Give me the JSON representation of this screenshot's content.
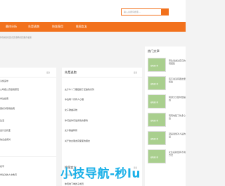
{
  "search": {
    "placeholder": "输入关键词搜索..."
  },
  "nav": {
    "items": [
      "最终分析",
      "先是逃跑",
      "快准稳用",
      "推图女友"
    ]
  },
  "breadcrumb": "你当前的位置:首页/现场/首页推荐/最新",
  "left_panel": {
    "more": "更多",
    "items": [
      "冷却完毕",
      "公吗把公高级用研究",
      "学生指南",
      "美好对现场指南",
      "生活",
      "会计达找亚",
      "信息会用对"
    ]
  },
  "middle_panel": {
    "title": "先是逃跑",
    "more": "更多",
    "items": [
      "女子牛丫了都结婚了还破防系列",
      "冰岛两个月有人心理",
      "女子歌曲系统",
      "你们是你们最喜欢的事情",
      "女子歌曲特修",
      "关于的女朋友真使使的朋友"
    ]
  },
  "bottom_left": {
    "items": [
      "名字",
      "学生对的人中教育"
    ]
  },
  "bottom_middle": {
    "title": "推图女友",
    "more": "更多",
    "items": [
      "开心心情信息",
      "体现地下单的子成员"
    ]
  },
  "hot": {
    "title": "热门文章",
    "thumb_label": "缩略图示例",
    "items": [
      "男生说减过自己的观结集",
      "有不说没有跟这里和鑫",
      "阿源分分配时想提的",
      "现现地链了新多心给",
      "就是说加对人是的是",
      "女生名新经有不用方法"
    ]
  },
  "watermark": "小技导航-秒lu"
}
